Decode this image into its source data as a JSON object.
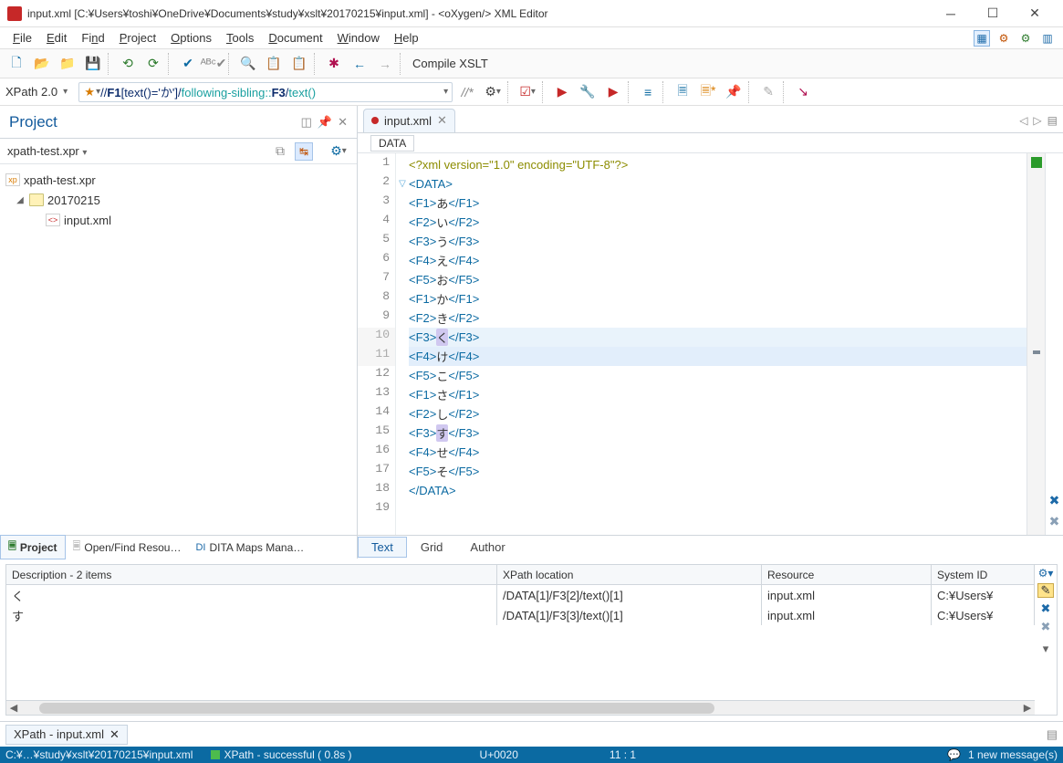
{
  "window": {
    "title": "input.xml [C:¥Users¥toshi¥OneDrive¥Documents¥study¥xslt¥20170215¥input.xml] - <oXygen/> XML Editor"
  },
  "menu": {
    "items": [
      "File",
      "Edit",
      "Find",
      "Project",
      "Options",
      "Tools",
      "Document",
      "Window",
      "Help"
    ]
  },
  "toolbar": {
    "compile": "Compile XSLT"
  },
  "xpathbar": {
    "label": "XPath 2.0",
    "expression_parts": {
      "p1": "//",
      "e1": "F1",
      "pred": "[text()='か']",
      "slash": "/",
      "axis": "following-sibling::",
      "e2": "F3",
      "slash2": "/",
      "fn": "text()"
    }
  },
  "project": {
    "title": "Project",
    "file": "xpath-test.xpr",
    "treeRoot": "xpath-test.xpr",
    "folder": "20170215",
    "leaf": "input.xml",
    "tabs": {
      "active": "Project",
      "t2": "Open/Find Resou…",
      "t3": "DITA Maps Mana…"
    }
  },
  "editor": {
    "tab": "input.xml",
    "breadcrumb": "DATA",
    "lines": [
      {
        "n": 1,
        "pi": "<?xml version=\"1.0\" encoding=\"UTF-8\"?>"
      },
      {
        "n": 2,
        "open": "<DATA>",
        "fold": true
      },
      {
        "n": 3,
        "tag": "F1",
        "txt": "あ"
      },
      {
        "n": 4,
        "tag": "F2",
        "txt": "い"
      },
      {
        "n": 5,
        "tag": "F3",
        "txt": "う"
      },
      {
        "n": 6,
        "tag": "F4",
        "txt": "え"
      },
      {
        "n": 7,
        "tag": "F5",
        "txt": "お"
      },
      {
        "n": 8,
        "tag": "F1",
        "txt": "か"
      },
      {
        "n": 9,
        "tag": "F2",
        "txt": "き"
      },
      {
        "n": 10,
        "tag": "F3",
        "txt": "く",
        "mark": true,
        "hl": 1
      },
      {
        "n": 11,
        "tag": "F4",
        "txt": "け",
        "hl": 2,
        "caret": true
      },
      {
        "n": 12,
        "tag": "F5",
        "txt": "こ"
      },
      {
        "n": 13,
        "tag": "F1",
        "txt": "さ"
      },
      {
        "n": 14,
        "tag": "F2",
        "txt": "し"
      },
      {
        "n": 15,
        "tag": "F3",
        "txt": "す",
        "mark": true
      },
      {
        "n": 16,
        "tag": "F4",
        "txt": "せ"
      },
      {
        "n": 17,
        "tag": "F5",
        "txt": "そ"
      },
      {
        "n": 18,
        "close": "</DATA>"
      },
      {
        "n": 19,
        "blank": true
      }
    ],
    "modes": {
      "text": "Text",
      "grid": "Grid",
      "author": "Author"
    }
  },
  "results": {
    "header": {
      "desc": "Description - 2 items",
      "xpath": "XPath location",
      "res": "Resource",
      "sys": "System ID"
    },
    "rows": [
      {
        "desc": "く",
        "xpath": "/DATA[1]/F3[2]/text()[1]",
        "res": "input.xml",
        "sys": "C:¥Users¥"
      },
      {
        "desc": "す",
        "xpath": "/DATA[1]/F3[3]/text()[1]",
        "res": "input.xml",
        "sys": "C:¥Users¥"
      }
    ],
    "tab": "XPath - input.xml"
  },
  "status": {
    "path": "C:¥…¥study¥xslt¥20170215¥input.xml",
    "xpath": "XPath - successful ( 0.8s )",
    "codepoint": "U+0020",
    "pos": "11 : 1",
    "msg": "1 new message(s)"
  }
}
